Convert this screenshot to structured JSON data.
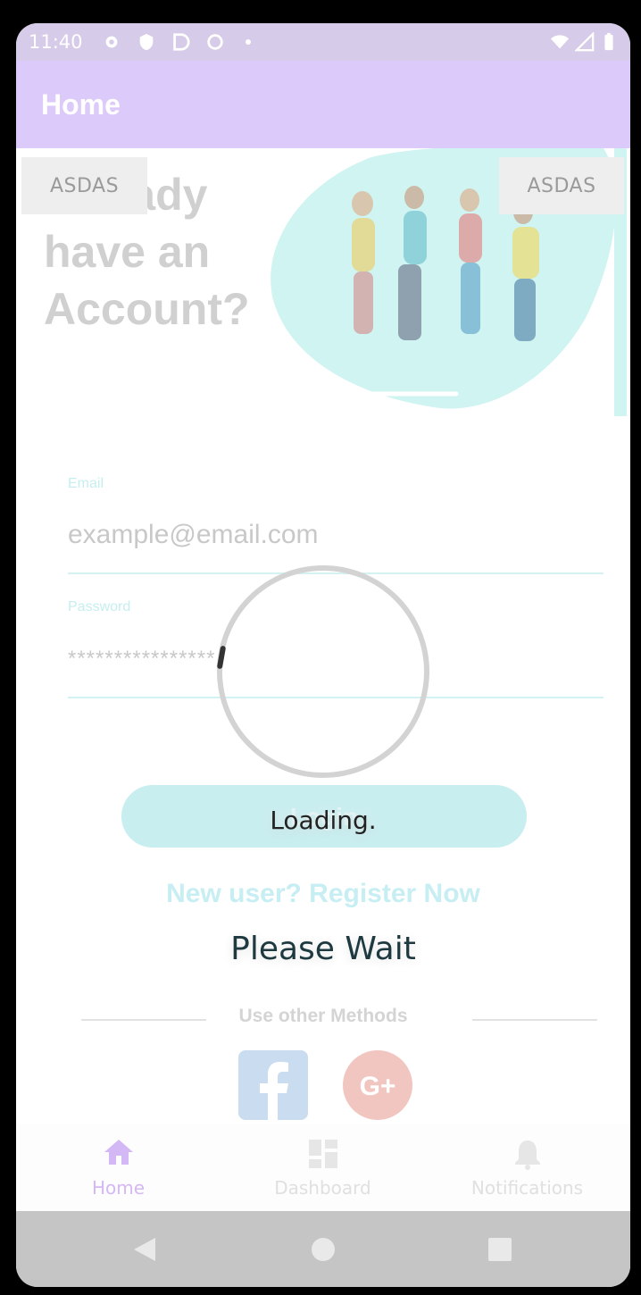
{
  "statusbar": {
    "time": "11:40"
  },
  "appbar": {
    "title": "Home"
  },
  "background": {
    "heading_line1": "Already",
    "heading_line2": "have an",
    "heading_line3": "Account?",
    "chip_left": "ASDAS",
    "chip_right": "ASDAS",
    "email_label": "Email",
    "email_placeholder": "example@email.com",
    "password_label": "Password",
    "password_value": "****************",
    "login_label": "Login",
    "register_link": "New user? Register Now",
    "other_methods": "Use other Methods"
  },
  "dialog": {
    "loading": "Loading.",
    "wait": "Please Wait"
  },
  "bottom_nav": [
    {
      "label": "Home",
      "icon": "home-icon",
      "active": true
    },
    {
      "label": "Dashboard",
      "icon": "dashboard-icon",
      "active": false
    },
    {
      "label": "Notifications",
      "icon": "bell-icon",
      "active": false
    }
  ],
  "colors": {
    "appbar": "#dccafa",
    "accent": "#c9eef0",
    "nav_active": "#d4b8f5"
  }
}
